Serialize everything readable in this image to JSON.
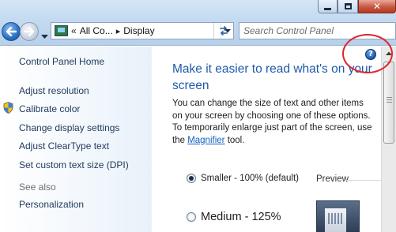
{
  "address_bar": {
    "breadcrumb_prefix": "«",
    "segment_1": "All Co...",
    "separator": "▸",
    "segment_2": "Display",
    "icon": "control-panel-icon"
  },
  "search": {
    "placeholder": "Search Control Panel",
    "value": ""
  },
  "sidebar": {
    "home": "Control Panel Home",
    "links": [
      "Adjust resolution",
      "Calibrate color",
      "Change display settings",
      "Adjust ClearType text",
      "Set custom text size (DPI)"
    ],
    "see_also_heading": "See also",
    "see_also_links": [
      "Personalization"
    ]
  },
  "main": {
    "title": "Make it easier to read what's on your screen",
    "description_before_link": "You can change the size of text and other items on your screen by choosing one of these options. To temporarily enlarge just part of the screen, use the ",
    "magnifier_link": "Magnifier",
    "description_after_link": " tool.",
    "options": [
      {
        "label": "Smaller - 100% (default)",
        "selected": true
      },
      {
        "label": "Medium - 125%",
        "selected": false
      }
    ],
    "preview_label": "Preview",
    "help_symbol": "?"
  },
  "colors": {
    "title_blue": "#1e5aa8",
    "link_blue": "#1560bd",
    "highlight_red": "#e0242c"
  }
}
